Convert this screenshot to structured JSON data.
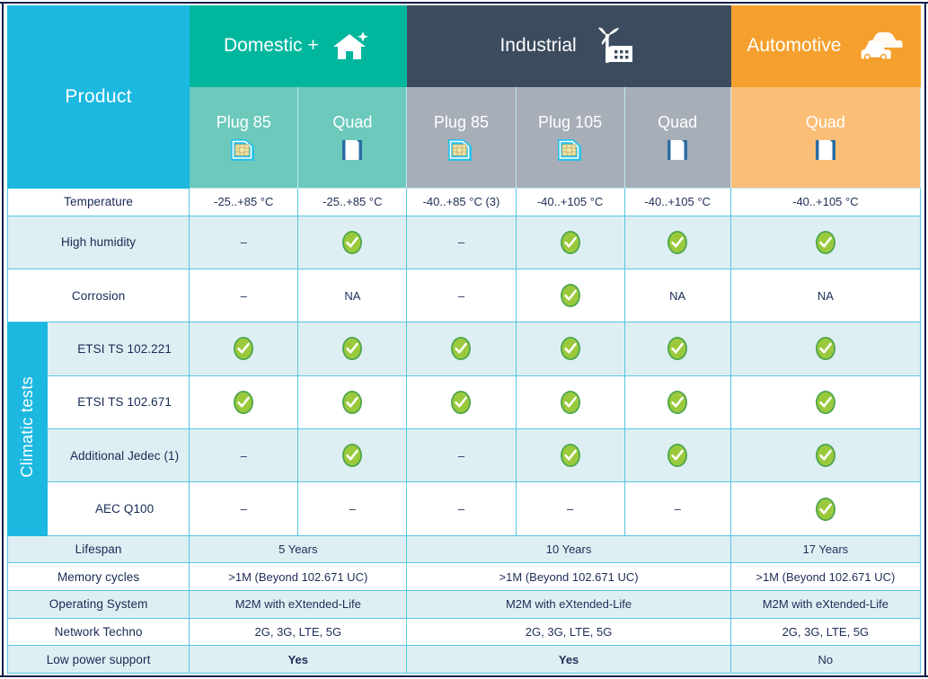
{
  "table": {
    "product_header": "Product",
    "climatic_band_label": "Climatic tests",
    "segments": [
      {
        "name": "Domestic +",
        "icon": "house-plus-icon",
        "color": "#00B79E"
      },
      {
        "name": "Industrial",
        "icon": "factory-windmill-icon",
        "color": "#3C4C5E"
      },
      {
        "name": "Automotive",
        "icon": "cars-icon",
        "color": "#F5A02E"
      }
    ],
    "variants": [
      {
        "label": "Plug 85",
        "icon": "sim-chip-icon",
        "segment": "Domestic +"
      },
      {
        "label": "Quad",
        "icon": "quad-chip-icon",
        "segment": "Domestic +"
      },
      {
        "label": "Plug 85",
        "icon": "sim-chip-icon",
        "segment": "Industrial"
      },
      {
        "label": "Plug 105",
        "icon": "sim-chip-icon",
        "segment": "Industrial"
      },
      {
        "label": "Quad",
        "icon": "quad-chip-icon",
        "segment": "Industrial"
      },
      {
        "label": "Quad",
        "icon": "quad-chip-icon",
        "segment": "Automotive"
      }
    ],
    "rows": [
      {
        "label": "Temperature",
        "cells": [
          "-25..+85 °C",
          "-25..+85 °C",
          "-40..+85 °C (3)",
          "-40..+105 °C",
          "-40..+105 °C",
          "-40..+105 °C"
        ]
      },
      {
        "label": "High humidity",
        "cells": [
          "–",
          "check",
          "–",
          "check",
          "check",
          "check"
        ]
      },
      {
        "label": "Corrosion",
        "cells": [
          "–",
          "NA",
          "–",
          "check",
          "NA",
          "NA"
        ]
      },
      {
        "label": "ETSI TS 102.221",
        "cells": [
          "check",
          "check",
          "check",
          "check",
          "check",
          "check"
        ]
      },
      {
        "label": "ETSI TS 102.671",
        "cells": [
          "check",
          "check",
          "check",
          "check",
          "check",
          "check"
        ]
      },
      {
        "label": "Additional Jedec (1)",
        "cells": [
          "–",
          "check",
          "–",
          "check",
          "check",
          "check"
        ]
      },
      {
        "label": "AEC Q100",
        "cells": [
          "–",
          "–",
          "–",
          "–",
          "–",
          "check"
        ]
      }
    ],
    "merged_rows": [
      {
        "label": "Lifespan",
        "cells": [
          "5 Years",
          "10 Years",
          "17 Years"
        ],
        "bold": false
      },
      {
        "label": "Memory cycles",
        "cells": [
          ">1M (Beyond 102.671 UC)",
          ">1M (Beyond 102.671 UC)",
          ">1M (Beyond 102.671 UC)"
        ],
        "bold": false
      },
      {
        "label": "Operating System",
        "cells": [
          "M2M with eXtended-Life",
          "M2M with eXtended-Life",
          "M2M with eXtended-Life"
        ],
        "bold": false
      },
      {
        "label": "Network Techno",
        "cells": [
          "2G, 3G, LTE, 5G",
          "2G, 3G, LTE, 5G",
          "2G, 3G, LTE, 5G"
        ],
        "bold": false
      },
      {
        "label": "Low power support",
        "cells": [
          "Yes",
          "Yes",
          "No"
        ],
        "bold": true
      }
    ],
    "colors": {
      "cyan": "#1CB8E0",
      "teal": "#00B79E",
      "teal_light": "#6CC9BC",
      "navy": "#3C4C5E",
      "gray_light": "#A7AEB8",
      "orange": "#F5A02E",
      "orange_light": "#FBBE76",
      "stripe": "#DEEFF3",
      "check_green": "#8DC63F",
      "text_navy": "#1d2d57",
      "grid": "#57c6e2"
    }
  }
}
